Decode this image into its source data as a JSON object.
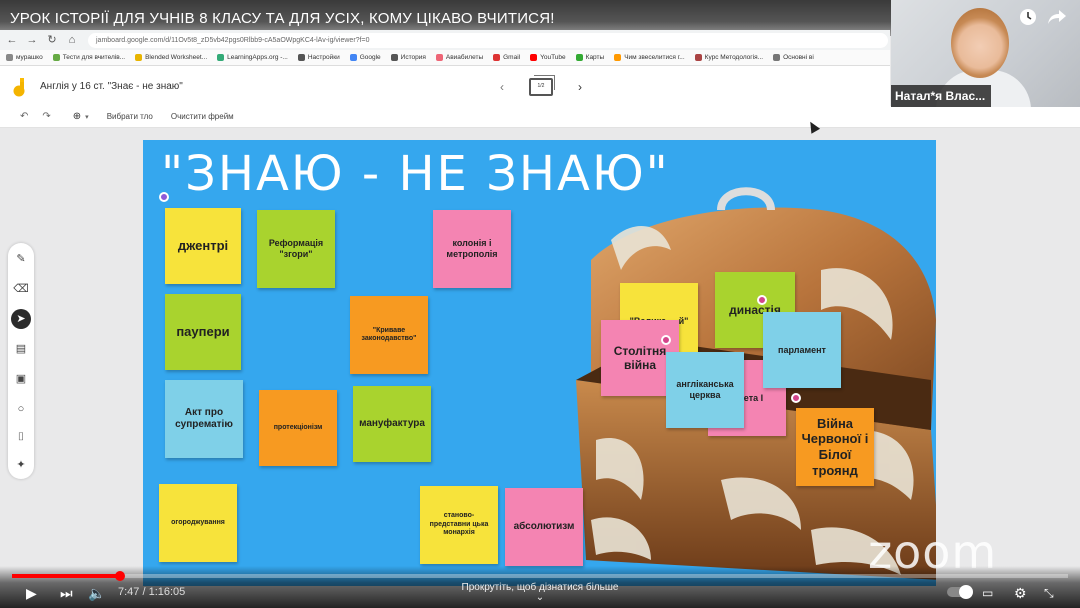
{
  "video": {
    "title": "УРОК ІСТОРІЇ ДЛЯ УЧНІВ 8 КЛАСУ ТА ДЛЯ УСІХ, КОМУ ЦІКАВО ВЧИТИСЯ!",
    "time": "7:47 / 1:16:05",
    "progress_fraction": 0.102,
    "hint": "Прокрутіть, щоб дізнатися більше",
    "hint_arrow": "⌄"
  },
  "browser": {
    "url": "jamboard.google.com/d/11Ov5t8_zD5vb42pgs0Rlbb9-cA5aOWpgKC4-lAv-ig/viewer?f=0",
    "bookmarks": [
      {
        "label": "мурашко",
        "color": "#888"
      },
      {
        "label": "Тести для вчителів...",
        "color": "#6a4"
      },
      {
        "label": "Blended Worksheet...",
        "color": "#e8b400"
      },
      {
        "label": "LearningApps.org -...",
        "color": "#3a7"
      },
      {
        "label": "Настройки",
        "color": "#555"
      },
      {
        "label": "Google",
        "color": "#4285f4"
      },
      {
        "label": "История",
        "color": "#555"
      },
      {
        "label": "Авиабилеты",
        "color": "#e67"
      },
      {
        "label": "Gmail",
        "color": "#d33"
      },
      {
        "label": "YouTube",
        "color": "#f00"
      },
      {
        "label": "Карты",
        "color": "#3a3"
      },
      {
        "label": "Чим звеселитися г...",
        "color": "#f90"
      },
      {
        "label": "Курс Методологія...",
        "color": "#a44"
      },
      {
        "label": "Основні ві",
        "color": "#777"
      }
    ]
  },
  "jamboard": {
    "title": "Англія у 16 ст. \"Знає - не знаю\"",
    "page": "1/2",
    "toolbar": {
      "set_background": "Вибрати тло",
      "clear_frame": "Очистити фрейм"
    }
  },
  "webcam": {
    "name": "Натал*я Влас..."
  },
  "board": {
    "title": "\"ЗНАЮ - НЕ ЗНАЮ\"",
    "notes": [
      {
        "text": "джентрі",
        "color": "#f7e33b"
      },
      {
        "text": "Реформація \"згори\"",
        "color": "#a9d32e"
      },
      {
        "text": "колонія і метрополія",
        "color": "#f484b2"
      },
      {
        "text": "паупери",
        "color": "#a9d32e"
      },
      {
        "text": "\"Криваве законодавство\"",
        "color": "#f79a21"
      },
      {
        "text": "Акт про супрематію",
        "color": "#7fd0e8"
      },
      {
        "text": "протекціонізм",
        "color": "#f79a21"
      },
      {
        "text": "мануфактура",
        "color": "#a9d32e"
      },
      {
        "text": "огороджування",
        "color": "#f7e33b"
      },
      {
        "text": "станово-представни цька монархія",
        "color": "#f7e33b"
      },
      {
        "text": "абсолютизм",
        "color": "#f484b2"
      },
      {
        "text": "\"Велика ... й\"",
        "color": "#f7e33b"
      },
      {
        "text": "династія",
        "color": "#a9d32e"
      },
      {
        "text": "Столітня війна",
        "color": "#f484b2"
      },
      {
        "text": "парламент",
        "color": "#7fd0e8"
      },
      {
        "text": "англіканська церква",
        "color": "#7fd0e8"
      },
      {
        "text": "...вета І",
        "color": "#f484b2"
      },
      {
        "text": "Війна Червоної і Білої троянд",
        "color": "#f79a21"
      }
    ]
  },
  "watermark": "zoom",
  "icons": {
    "clock": "clock-icon",
    "share": "share-icon"
  }
}
